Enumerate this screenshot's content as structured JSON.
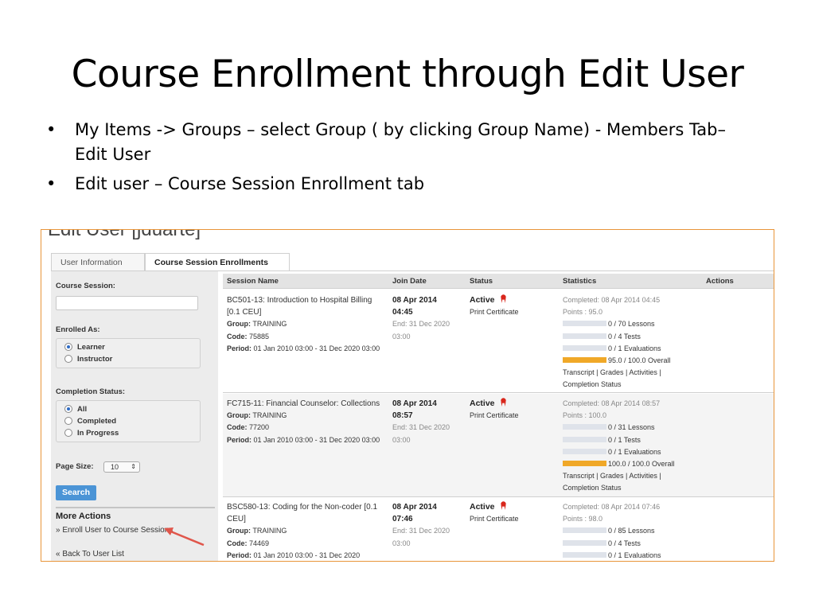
{
  "slide": {
    "title": "Course Enrollment through Edit User",
    "bullets": [
      "My Items -> Groups – select Group ( by clicking Group Name) - Members Tab– Edit User",
      "Edit user – Course Session Enrollment tab"
    ]
  },
  "screen": {
    "heading": "Edit User [jduarte]",
    "tabs": [
      "User Information",
      "Course Session Enrollments"
    ],
    "filters": {
      "course_session_label": "Course Session:",
      "enrolled_as_label": "Enrolled As:",
      "enrolled_options": [
        "Learner",
        "Instructor"
      ],
      "enrolled_selected": "Learner",
      "completion_label": "Completion Status:",
      "completion_options": [
        "All",
        "Completed",
        "In Progress"
      ],
      "completion_selected": "All",
      "page_size_label": "Page Size:",
      "page_size_value": "10",
      "page_size_arrow": "⇕",
      "search_label": "Search"
    },
    "more_actions": {
      "title": "More Actions",
      "links": [
        "» Enroll User to Course Sessions",
        "« Back To User List"
      ]
    },
    "table": {
      "headers": [
        "Session Name",
        "Join Date",
        "Status",
        "Statistics",
        "Actions"
      ],
      "rows": [
        {
          "name": "BC501-13: Introduction to Hospital Billing [0.1 CEU]",
          "group_label": "Group:",
          "group": "TRAINING",
          "code_label": "Code:",
          "code": "75885",
          "period_label": "Period:",
          "period": "01 Jan 2010 03:00 - 31 Dec 2020 03:00",
          "join_date": "08 Apr 2014",
          "join_time": "04:45",
          "end_date": "End: 31 Dec 2020",
          "end_time": "03:00",
          "status": "Active",
          "print_cert": "Print Certificate",
          "completed": "Completed: 08 Apr 2014 04:45",
          "points": "Points : 95.0",
          "lessons": "0 / 70 Lessons",
          "tests": "0 / 4 Tests",
          "evaluations": "0 / 1 Evaluations",
          "overall": "95.0 / 100.0 Overall",
          "links": "Transcript | Grades | Activities |",
          "links2": "Completion Status"
        },
        {
          "name": "FC715-11: Financial Counselor: Collections",
          "group_label": "Group:",
          "group": "TRAINING",
          "code_label": "Code:",
          "code": "77200",
          "period_label": "Period:",
          "period": "01 Jan 2010 03:00 - 31 Dec 2020 03:00",
          "join_date": "08 Apr 2014",
          "join_time": "08:57",
          "end_date": "End: 31 Dec 2020",
          "end_time": "03:00",
          "status": "Active",
          "print_cert": "Print Certificate",
          "completed": "Completed: 08 Apr 2014 08:57",
          "points": "Points : 100.0",
          "lessons": "0 / 31 Lessons",
          "tests": "0 / 1 Tests",
          "evaluations": "0 / 1 Evaluations",
          "overall": "100.0 / 100.0 Overall",
          "links": "Transcript | Grades | Activities |",
          "links2": "Completion Status"
        },
        {
          "name": "BSC580-13: Coding for the Non-coder [0.1 CEU]",
          "group_label": "Group:",
          "group": "TRAINING",
          "code_label": "Code:",
          "code": "74469",
          "period_label": "Period:",
          "period": "01 Jan 2010 03:00 - 31 Dec 2020",
          "join_date": "08 Apr 2014",
          "join_time": "07:46",
          "end_date": "End: 31 Dec 2020",
          "end_time": "03:00",
          "status": "Active",
          "print_cert": "Print Certificate",
          "completed": "Completed: 08 Apr 2014 07:46",
          "points": "Points : 98.0",
          "lessons": "0 / 85 Lessons",
          "tests": "0 / 4 Tests",
          "evaluations": "0 / 1 Evaluations"
        }
      ]
    }
  },
  "colors": {
    "accent": "#4b94d6",
    "frame": "#e8953a",
    "bar_fill": "#f0a828",
    "ribbon": "#d9271c"
  }
}
